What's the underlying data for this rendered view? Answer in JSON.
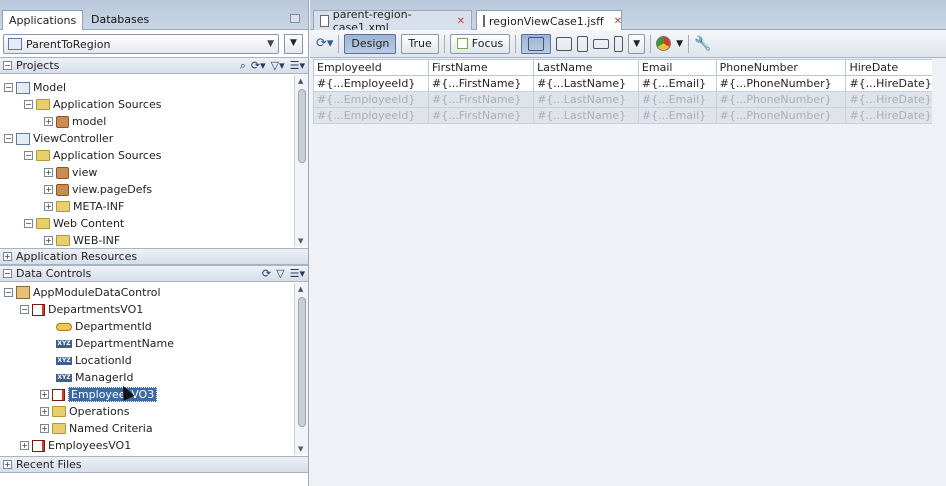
{
  "left": {
    "tabs": [
      {
        "label": "Applications"
      },
      {
        "label": "Databases"
      }
    ],
    "app_selector": {
      "value": "ParentToRegion"
    },
    "projects_header": "Projects",
    "projects_tree": [
      {
        "label": "Model"
      },
      {
        "label": "Application Sources"
      },
      {
        "label": "model"
      },
      {
        "label": "ViewController"
      },
      {
        "label": "Application Sources"
      },
      {
        "label": "view"
      },
      {
        "label": "view.pageDefs"
      },
      {
        "label": "META-INF"
      },
      {
        "label": "Web Content"
      },
      {
        "label": "WEB-INF"
      }
    ],
    "app_resources_header": "Application Resources",
    "data_controls_header": "Data Controls",
    "data_tree": [
      {
        "label": "AppModuleDataControl"
      },
      {
        "label": "DepartmentsVO1"
      },
      {
        "label": "DepartmentId"
      },
      {
        "label": "DepartmentName"
      },
      {
        "label": "LocationId"
      },
      {
        "label": "ManagerId"
      },
      {
        "label": "EmployeesVO3"
      },
      {
        "label": "Operations"
      },
      {
        "label": "Named Criteria"
      },
      {
        "label": "EmployeesVO1"
      }
    ],
    "recent_files_header": "Recent Files"
  },
  "editor": {
    "tabs": [
      {
        "label": "parent-region-case1.xml"
      },
      {
        "label": "regionViewCase1.jsff"
      }
    ],
    "toolbar": {
      "design": "Design",
      "true": "True",
      "focus": "Focus"
    },
    "table": {
      "columns": [
        "EmployeeId",
        "FirstName",
        "LastName",
        "Email",
        "PhoneNumber",
        "HireDate"
      ],
      "rows": [
        [
          "#{...EmployeeId}",
          "#{...FirstName}",
          "#{...LastName}",
          "#{...Email}",
          "#{...PhoneNumber}",
          "#{...HireDate}"
        ],
        [
          "#{...EmployeeId}",
          "#{...FirstName}",
          "#{...LastName}",
          "#{...Email}",
          "#{...PhoneNumber}",
          "#{...HireDate}"
        ],
        [
          "#{...EmployeeId}",
          "#{...FirstName}",
          "#{...LastName}",
          "#{...Email}",
          "#{...PhoneNumber}",
          "#{...HireDate}"
        ]
      ]
    }
  }
}
